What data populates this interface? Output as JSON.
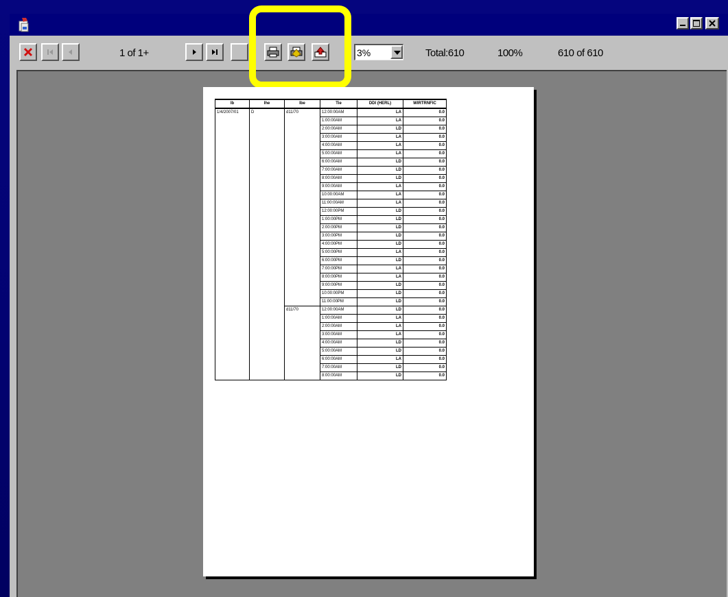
{
  "window": {
    "app_icon": "report-viewer-icon",
    "buttons": [
      "minimize-icon",
      "maximize-icon",
      "close-icon"
    ]
  },
  "toolbar": {
    "page_indicator": "1 of 1+",
    "zoom_value": "3%",
    "total_label": "Total:610",
    "percent_label": "100%",
    "records_label": "610 of 610",
    "icons": [
      "close-report-icon",
      "first-page-icon",
      "previous-page-icon",
      "next-page-icon",
      "last-page-icon",
      "stop-icon",
      "print-icon",
      "print-setup-icon",
      "export-icon"
    ],
    "colors": {
      "close_x": "#d01010",
      "highlight": "#ffff00"
    }
  },
  "report": {
    "headers": [
      "Ib",
      "Ihe",
      "Ibe",
      "Tie",
      "DDI (HERL)",
      "WIRTRNFIC"
    ],
    "rows": [
      [
        "1/4/2007/01",
        "D",
        "d11/70",
        "12:00:00AM",
        "LA",
        "0.0"
      ],
      [
        "",
        "",
        "",
        "1:00:00AM",
        "LA",
        "0.0"
      ],
      [
        "",
        "",
        "",
        "2:00:00AM",
        "LD",
        "0.0"
      ],
      [
        "",
        "",
        "",
        "3:00:00AM",
        "LA",
        "0.0"
      ],
      [
        "",
        "",
        "",
        "4:00:00AM",
        "LA",
        "0.0"
      ],
      [
        "",
        "",
        "",
        "5:00:00AM",
        "LA",
        "0.0"
      ],
      [
        "",
        "",
        "",
        "6:00:00AM",
        "LD",
        "0.0"
      ],
      [
        "",
        "",
        "",
        "7:00:00AM",
        "LD",
        "0.0"
      ],
      [
        "",
        "",
        "",
        "8:00:00AM",
        "LD",
        "0.0"
      ],
      [
        "",
        "",
        "",
        "9:00:00AM",
        "LA",
        "0.0"
      ],
      [
        "",
        "",
        "",
        "10:00:00AM",
        "LA",
        "0.0"
      ],
      [
        "",
        "",
        "",
        "11:00:00AM",
        "LA",
        "0.0"
      ],
      [
        "",
        "",
        "",
        "12:00:00PM",
        "LD",
        "0.0"
      ],
      [
        "",
        "",
        "",
        "1:00:00PM",
        "LD",
        "0.0"
      ],
      [
        "",
        "",
        "",
        "2:00:00PM",
        "LD",
        "0.0"
      ],
      [
        "",
        "",
        "",
        "3:00:00PM",
        "LD",
        "0.0"
      ],
      [
        "",
        "",
        "",
        "4:00:00PM",
        "LD",
        "0.0"
      ],
      [
        "",
        "",
        "",
        "5:00:00PM",
        "LA",
        "0.0"
      ],
      [
        "",
        "",
        "",
        "6:00:00PM",
        "LD",
        "0.0"
      ],
      [
        "",
        "",
        "",
        "7:00:00PM",
        "LA",
        "0.0"
      ],
      [
        "",
        "",
        "",
        "8:00:00PM",
        "LA",
        "0.0"
      ],
      [
        "",
        "",
        "",
        "9:00:00PM",
        "LD",
        "0.0"
      ],
      [
        "",
        "",
        "",
        "10:00:00PM",
        "LD",
        "0.0"
      ],
      [
        "",
        "",
        "",
        "11:00:00PM",
        "LD",
        "0.0"
      ],
      [
        "",
        "",
        "d11/70",
        "12:00:00AM",
        "LD",
        "0.0"
      ],
      [
        "",
        "",
        "",
        "1:00:00AM",
        "LA",
        "0.0"
      ],
      [
        "",
        "",
        "",
        "2:00:00AM",
        "LA",
        "0.0"
      ],
      [
        "",
        "",
        "",
        "3:00:00AM",
        "LA",
        "0.0"
      ],
      [
        "",
        "",
        "",
        "4:00:00AM",
        "LD",
        "0.0"
      ],
      [
        "",
        "",
        "",
        "5:00:00AM",
        "LD",
        "0.0"
      ],
      [
        "",
        "",
        "",
        "6:00:00AM",
        "LA",
        "0.0"
      ],
      [
        "",
        "",
        "",
        "7:00:00AM",
        "LD",
        "0.0"
      ],
      [
        "",
        "",
        "",
        "8:00:00AM",
        "LD",
        "0.0"
      ]
    ]
  }
}
